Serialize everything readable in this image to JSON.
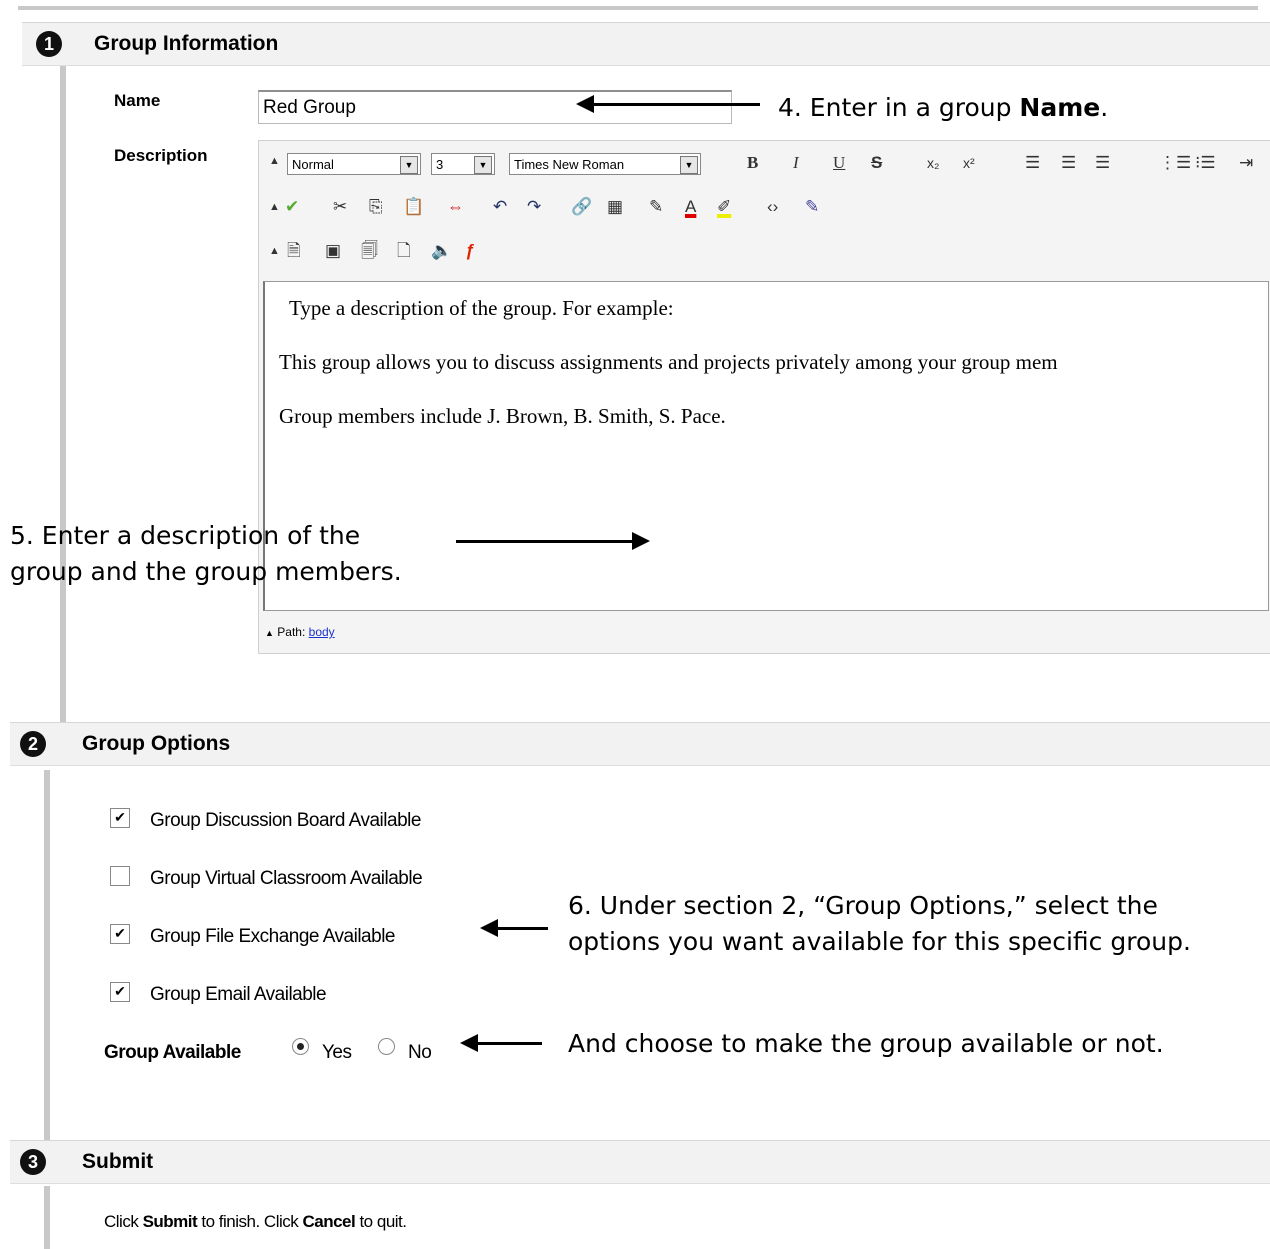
{
  "sections": [
    {
      "number": "1",
      "title": "Group Information"
    },
    {
      "number": "2",
      "title": "Group Options"
    },
    {
      "number": "3",
      "title": "Submit"
    }
  ],
  "group_info": {
    "name_label": "Name",
    "name_value": "Red Group",
    "description_label": "Description"
  },
  "editor": {
    "format_select": "Normal",
    "size_select": "3",
    "font_select": "Times New Roman",
    "content": [
      "Type a description of the group.  For example:",
      "This group allows you to discuss assignments and projects privately among your group mem",
      "Group members include J. Brown, B. Smith, S. Pace."
    ],
    "path_label": "Path:",
    "path_link": "body"
  },
  "options": [
    {
      "label": "Group Discussion Board Available",
      "checked": true
    },
    {
      "label": "Group Virtual Classroom Available",
      "checked": false
    },
    {
      "label": "Group File Exchange Available",
      "checked": true
    },
    {
      "label": "Group Email Available",
      "checked": true
    }
  ],
  "availability": {
    "label": "Group Available",
    "yes": "Yes",
    "no": "No",
    "selected": "Yes"
  },
  "submit": {
    "text_pre": "Click ",
    "submit_word": "Submit",
    "text_mid": " to finish. Click ",
    "cancel_word": "Cancel",
    "text_post": " to quit."
  },
  "annotations": {
    "step4_pre": "4. Enter in a group ",
    "step4_bold": "Name",
    "step4_post": ".",
    "step5_line1": "5. Enter a description of the",
    "step5_line2": "group and the group members.",
    "step6_line1": "6. Under section 2, “Group Options,” select the",
    "step6_line2": "options you want available for this specific group.",
    "step7": "And choose to make the group available or not."
  }
}
